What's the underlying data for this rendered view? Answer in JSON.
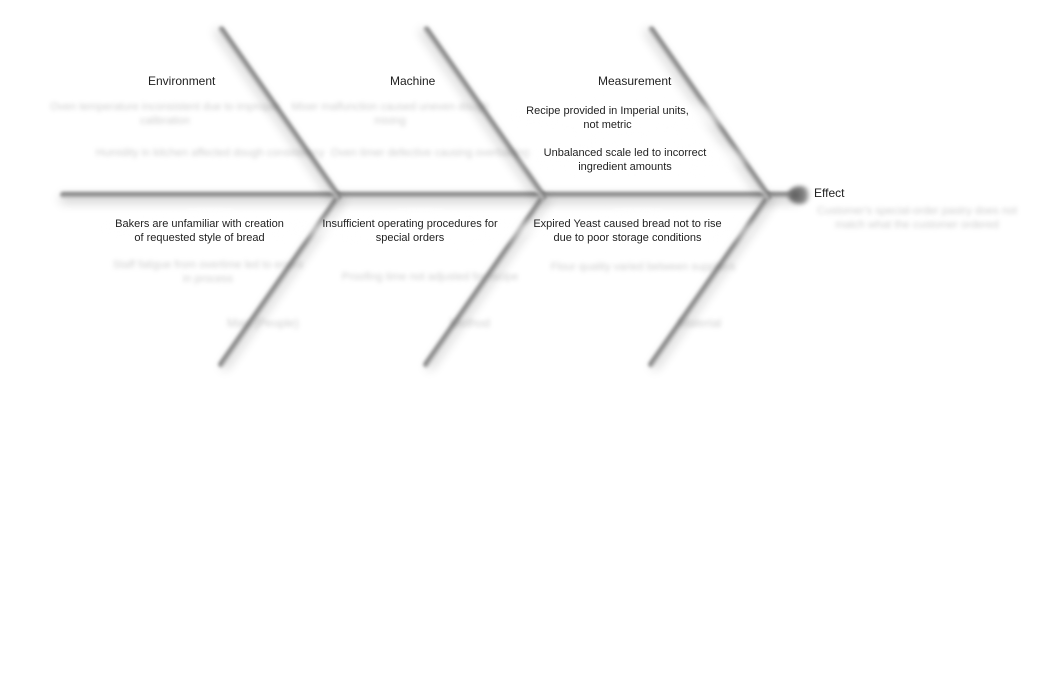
{
  "diagram_type": "fishbone",
  "head": {
    "label": "Effect"
  },
  "upper_categories": [
    {
      "name": "Environment",
      "causes_ghost": [
        "Oven temperature inconsistent due to improper calibration",
        "Humidity in kitchen affected dough consistency"
      ]
    },
    {
      "name": "Machine",
      "causes_ghost": [
        "Mixer malfunction caused uneven dough mixing",
        "Oven timer defective causing overbaking"
      ]
    },
    {
      "name": "Measurement",
      "causes": [
        "Recipe provided in Imperial units, not metric",
        "Unbalanced scale led to incorrect ingredient amounts"
      ]
    }
  ],
  "lower_categories": [
    {
      "name_ghost": "Man (People)",
      "causes": [
        "Bakers are unfamiliar with creation of requested style of bread"
      ],
      "causes_ghost": [
        "Staff fatigue from overtime led to errors in process"
      ]
    },
    {
      "name_ghost": "Method",
      "causes": [
        "Insufficient operating procedures for special orders"
      ],
      "causes_ghost": [
        "Proofing time not adjusted for recipe"
      ]
    },
    {
      "name_ghost": "Material",
      "causes": [
        "Expired Yeast caused bread not to rise due to poor storage conditions"
      ],
      "causes_ghost": [
        "Flour quality varied between suppliers"
      ]
    }
  ],
  "effect_ghost": "Customer's special-order pastry does not match what the customer ordered"
}
